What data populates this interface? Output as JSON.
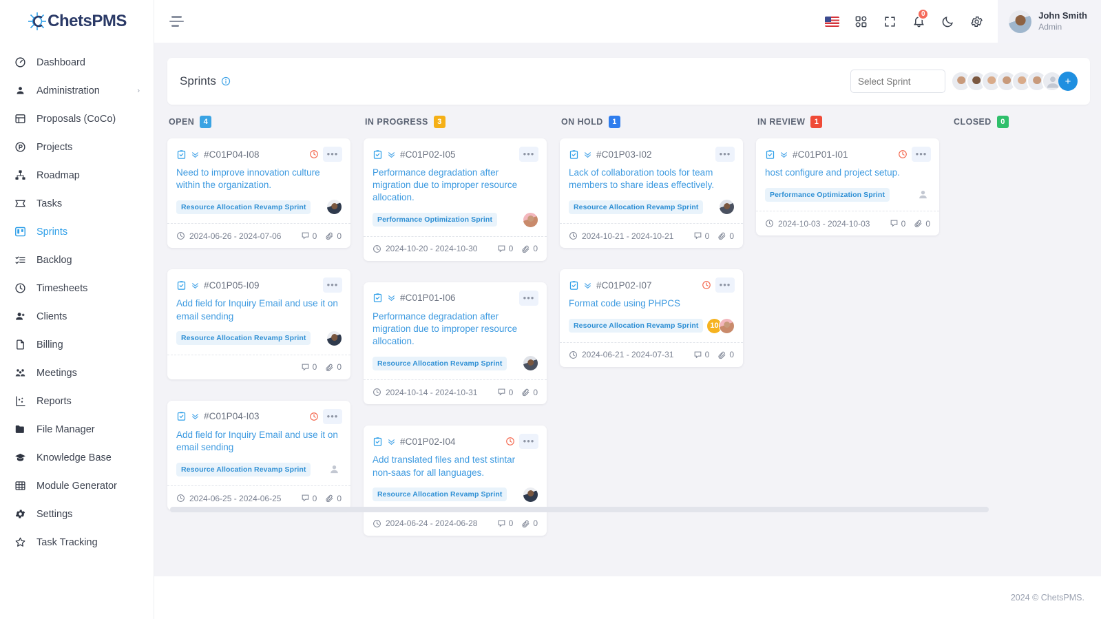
{
  "brand": {
    "name": "ChetsPMS",
    "logo_icon": "chets-logo-icon"
  },
  "sidebar": {
    "items": [
      {
        "label": "Dashboard",
        "icon": "dashboard-icon",
        "active": false,
        "chevron": ""
      },
      {
        "label": "Administration",
        "icon": "user-circle-icon",
        "active": false,
        "chevron": "›"
      },
      {
        "label": "Proposals (CoCo)",
        "icon": "proposal-icon",
        "active": false,
        "chevron": ""
      },
      {
        "label": "Projects",
        "icon": "projects-icon",
        "active": false,
        "chevron": ""
      },
      {
        "label": "Roadmap",
        "icon": "roadmap-icon",
        "active": false,
        "chevron": ""
      },
      {
        "label": "Tasks",
        "icon": "tasks-icon",
        "active": false,
        "chevron": ""
      },
      {
        "label": "Sprints",
        "icon": "sprints-icon",
        "active": true,
        "chevron": ""
      },
      {
        "label": "Backlog",
        "icon": "backlog-icon",
        "active": false,
        "chevron": ""
      },
      {
        "label": "Timesheets",
        "icon": "clock-icon",
        "active": false,
        "chevron": ""
      },
      {
        "label": "Clients",
        "icon": "clients-icon",
        "active": false,
        "chevron": ""
      },
      {
        "label": "Billing",
        "icon": "billing-icon",
        "active": false,
        "chevron": ""
      },
      {
        "label": "Meetings",
        "icon": "meetings-icon",
        "active": false,
        "chevron": ""
      },
      {
        "label": "Reports",
        "icon": "reports-icon",
        "active": false,
        "chevron": ""
      },
      {
        "label": "File Manager",
        "icon": "folder-icon",
        "active": false,
        "chevron": ""
      },
      {
        "label": "Knowledge Base",
        "icon": "graduation-cap-icon",
        "active": false,
        "chevron": ""
      },
      {
        "label": "Module Generator",
        "icon": "grid-icon",
        "active": false,
        "chevron": ""
      },
      {
        "label": "Settings",
        "icon": "gear-icon",
        "active": false,
        "chevron": ""
      },
      {
        "label": "Task Tracking",
        "icon": "star-icon",
        "active": false,
        "chevron": ""
      }
    ]
  },
  "topbar": {
    "menu_icon": "hamburger-menu-icon",
    "icons": [
      {
        "name": "language-flag-icon",
        "label": "US"
      },
      {
        "name": "apps-grid-icon",
        "label": ""
      },
      {
        "name": "fullscreen-icon",
        "label": ""
      },
      {
        "name": "bell-icon",
        "label": ""
      },
      {
        "name": "dark-mode-moon-icon",
        "label": ""
      },
      {
        "name": "gear-icon",
        "label": ""
      }
    ],
    "notification_count": "0",
    "user": {
      "name": "John Smith",
      "role": "Admin",
      "avatar": "user-avatar"
    }
  },
  "panel": {
    "title": "Sprints",
    "info_icon": "info-circle-icon",
    "select_placeholder": "Select Sprint",
    "select_value": "",
    "add_member_label": "+",
    "avatars": [
      "member-1",
      "member-2",
      "member-3",
      "member-4",
      "member-5",
      "member-6",
      "member-7"
    ]
  },
  "board": {
    "columns": [
      {
        "title": "OPEN",
        "count": "4",
        "color": "#3aa3e3",
        "cards": [
          {
            "id": "#C01P04-I08",
            "title": "Need to improve innovation culture within the organization.",
            "tag": "Resource Allocation Revamp Sprint",
            "date": "2024-06-26 - 2024-07-06",
            "comments": "0",
            "attachments": "0",
            "overdue": true,
            "assignee": "avatar-woman-dark",
            "badge": ""
          },
          {
            "id": "#C01P05-I09",
            "title": "Add field for Inquiry Email and use it on email sending",
            "tag": "Resource Allocation Revamp Sprint",
            "date": "",
            "comments": "0",
            "attachments": "0",
            "overdue": false,
            "assignee": "avatar-woman-dark",
            "badge": ""
          },
          {
            "id": "#C01P04-I03",
            "title": "Add field for Inquiry Email and use it on email sending",
            "tag": "Resource Allocation Revamp Sprint",
            "date": "2024-06-25 - 2024-06-25",
            "comments": "0",
            "attachments": "0",
            "overdue": true,
            "assignee": "avatar-placeholder",
            "badge": ""
          }
        ]
      },
      {
        "title": "IN PROGRESS",
        "count": "3",
        "color": "#f5b017",
        "cards": [
          {
            "id": "#C01P02-I05",
            "title": "Performance degradation after migration due to improper resource allocation.",
            "tag": "Performance Optimization Sprint",
            "date": "2024-10-20 - 2024-10-30",
            "comments": "0",
            "attachments": "0",
            "overdue": false,
            "assignee": "avatar-man-pink",
            "badge": ""
          },
          {
            "id": "#C01P01-I06",
            "title": "Performance degradation after migration due to improper resource allocation.",
            "tag": "Resource Allocation Revamp Sprint",
            "date": "2024-10-14 - 2024-10-31",
            "comments": "0",
            "attachments": "0",
            "overdue": false,
            "assignee": "avatar-man-gray",
            "badge": ""
          },
          {
            "id": "#C01P02-I04",
            "title": "Add translated files and test stintar non-saas for all languages.",
            "tag": "Resource Allocation Revamp Sprint",
            "date": "2024-06-24 - 2024-06-28",
            "comments": "0",
            "attachments": "0",
            "overdue": true,
            "assignee": "avatar-woman-dark",
            "badge": ""
          }
        ]
      },
      {
        "title": "ON HOLD",
        "count": "1",
        "color": "#2f7ded",
        "cards": [
          {
            "id": "#C01P03-I02",
            "title": "Lack of collaboration tools for team members to share ideas effectively.",
            "tag": "Resource Allocation Revamp Sprint",
            "date": "2024-10-21 - 2024-10-21",
            "comments": "0",
            "attachments": "0",
            "overdue": false,
            "assignee": "avatar-man-dark",
            "badge": ""
          },
          {
            "id": "#C01P02-I07",
            "title": "Format code using PHPCS",
            "tag": "Resource Allocation Revamp Sprint",
            "date": "2024-06-21 - 2024-07-31",
            "comments": "0",
            "attachments": "0",
            "overdue": true,
            "assignee": "avatar-man-pink",
            "badge": "10"
          }
        ]
      },
      {
        "title": "IN REVIEW",
        "count": "1",
        "color": "#ef4a37",
        "cards": [
          {
            "id": "#C01P01-I01",
            "title": "host configure and project setup.",
            "tag": "Performance Optimization Sprint",
            "date": "2024-10-03 - 2024-10-03",
            "comments": "0",
            "attachments": "0",
            "overdue": true,
            "assignee": "avatar-placeholder",
            "badge": ""
          }
        ]
      },
      {
        "title": "CLOSED",
        "count": "0",
        "color": "#2fbf6b",
        "cards": []
      }
    ]
  },
  "footer": {
    "text": "2024 © ChetsPMS."
  }
}
